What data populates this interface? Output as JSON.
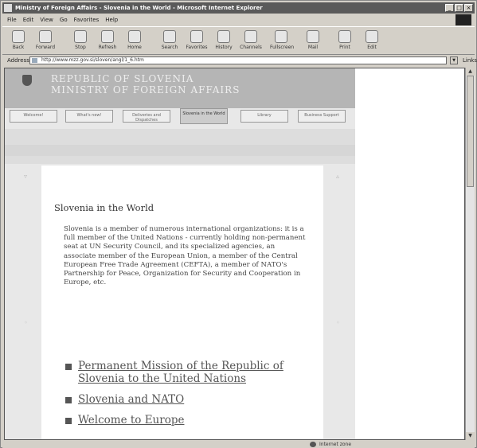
{
  "window": {
    "title": "Ministry of Foreign Affairs - Slovenia in the World - Microsoft Internet Explorer",
    "buttons": [
      "_",
      "□",
      "×"
    ]
  },
  "menu": [
    "File",
    "Edit",
    "View",
    "Go",
    "Favorites",
    "Help"
  ],
  "toolbar": [
    {
      "label": "Back",
      "icon": "back-icon"
    },
    {
      "label": "Forward",
      "icon": "forward-icon"
    },
    {
      "label": "Stop",
      "icon": "stop-icon"
    },
    {
      "label": "Refresh",
      "icon": "refresh-icon"
    },
    {
      "label": "Home",
      "icon": "home-icon"
    },
    {
      "label": "Search",
      "icon": "search-icon"
    },
    {
      "label": "Favorites",
      "icon": "favorites-icon"
    },
    {
      "label": "History",
      "icon": "history-icon"
    },
    {
      "label": "Channels",
      "icon": "channels-icon"
    },
    {
      "label": "Fullscreen",
      "icon": "fullscreen-icon"
    },
    {
      "label": "Mail",
      "icon": "mail-icon"
    },
    {
      "label": "Print",
      "icon": "print-icon"
    },
    {
      "label": "Edit",
      "icon": "edit-icon"
    }
  ],
  "address": {
    "label": "Address",
    "url": "http://www.mzz.gov.si/sloven/angl/1_6.htm",
    "links": "Links"
  },
  "site": {
    "republic": "REPUBLIC OF SLOVENIA",
    "ministry": "MINISTRY OF FOREIGN AFFAIRS",
    "tabs": [
      {
        "label": "Welcome!",
        "active": false
      },
      {
        "label": "What's new!",
        "active": false
      },
      {
        "label": "Deliveries and Dispatches",
        "active": false
      },
      {
        "label": "Slovenia in the World",
        "active": true
      },
      {
        "label": "Library",
        "active": false
      },
      {
        "label": "Business Support",
        "active": false
      }
    ]
  },
  "content": {
    "title": "Slovenia in the World",
    "intro": "Slovenia is a member of numerous international organizations: it is a full member of the United Nations - currently holding non-permanent seat at UN Security Council, and its specialized agencies, an associate member of the European Union, a member of the Central European Free Trade Agreement (CEFTA), a member of NATO's Partnership for Peace, Organization for Security and Cooperation in Europe, etc.",
    "links": [
      "Permanent Mission of the Republic of Slovenia to the United Nations",
      "Slovenia and NATO",
      "Welcome to Europe"
    ]
  },
  "status": {
    "zone": "Internet zone"
  },
  "colors": {
    "header_bg": "#b5b5b5",
    "page_bg": "#e8e8e8",
    "title_bar": "#5a5a5a"
  }
}
